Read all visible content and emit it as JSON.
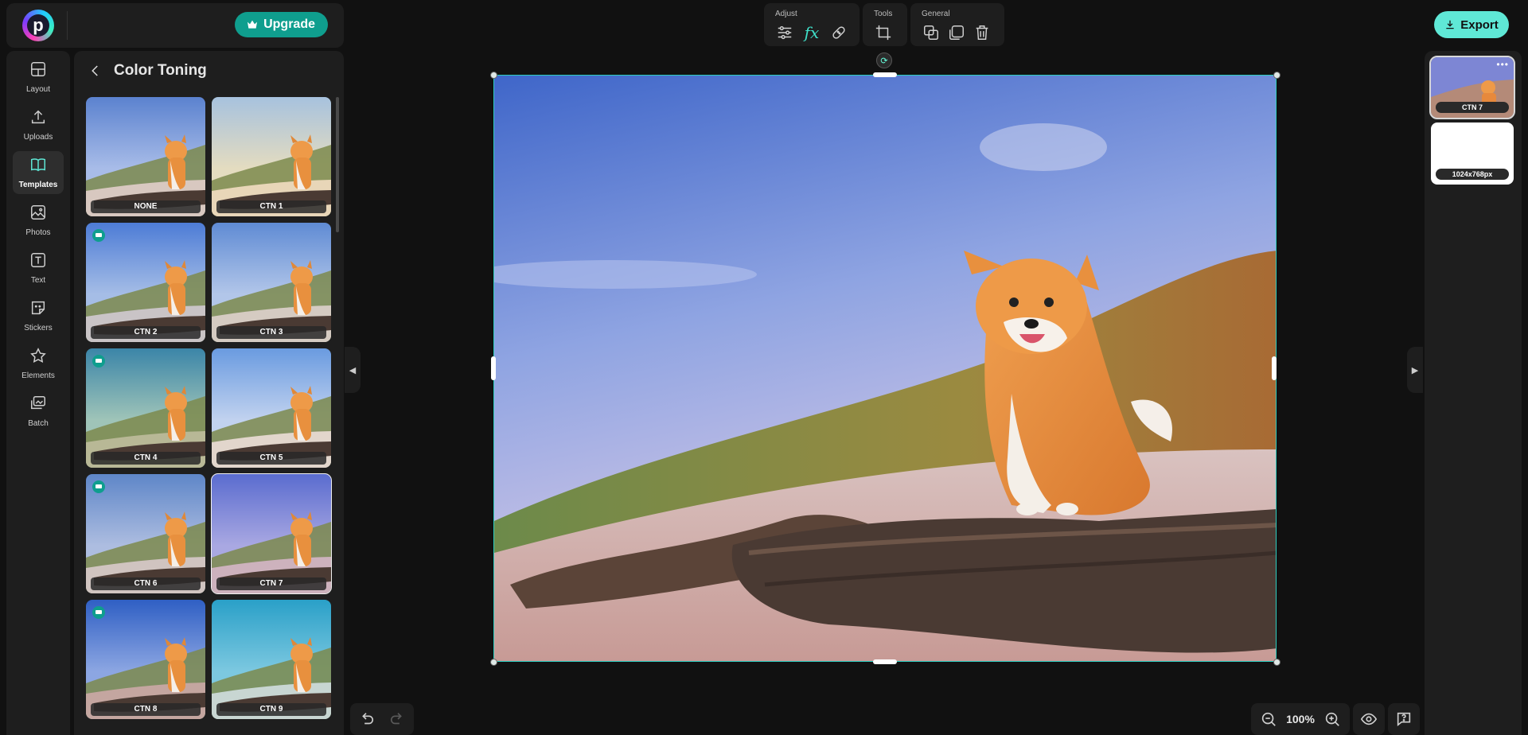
{
  "header": {
    "logo_letter": "p",
    "upgrade_label": "Upgrade",
    "export_label": "Export",
    "tool_groups": [
      {
        "label": "Adjust",
        "icons": [
          "sliders-icon",
          "fx-icon",
          "bandage-icon"
        ]
      },
      {
        "label": "Tools",
        "icons": [
          "crop-icon"
        ]
      },
      {
        "label": "General",
        "icons": [
          "duplicate-icon",
          "copy-icon",
          "trash-icon"
        ]
      }
    ],
    "fx_text": "fx"
  },
  "rail": {
    "items": [
      {
        "label": "Layout",
        "icon": "layout-icon"
      },
      {
        "label": "Uploads",
        "icon": "upload-icon"
      },
      {
        "label": "Templates",
        "icon": "book-icon",
        "active": true
      },
      {
        "label": "Photos",
        "icon": "image-icon"
      },
      {
        "label": "Text",
        "icon": "text-icon"
      },
      {
        "label": "Stickers",
        "icon": "sticker-icon"
      },
      {
        "label": "Elements",
        "icon": "star-icon"
      },
      {
        "label": "Batch",
        "icon": "batch-icon"
      }
    ]
  },
  "panel": {
    "title": "Color Toning",
    "filters": [
      {
        "label": "NONE",
        "premium": false,
        "selected": false,
        "tone": "none"
      },
      {
        "label": "CTN 1",
        "premium": false,
        "selected": false,
        "tone": "warm-haze"
      },
      {
        "label": "CTN 2",
        "premium": true,
        "selected": false,
        "tone": "cool"
      },
      {
        "label": "CTN 3",
        "premium": false,
        "selected": false,
        "tone": "natural"
      },
      {
        "label": "CTN 4",
        "premium": true,
        "selected": false,
        "tone": "green"
      },
      {
        "label": "CTN 5",
        "premium": false,
        "selected": false,
        "tone": "bright"
      },
      {
        "label": "CTN 6",
        "premium": true,
        "selected": false,
        "tone": "soft"
      },
      {
        "label": "CTN 7",
        "premium": false,
        "selected": true,
        "tone": "violet"
      },
      {
        "label": "CTN 8",
        "premium": true,
        "selected": false,
        "tone": "deep-blue"
      },
      {
        "label": "CTN 9",
        "premium": false,
        "selected": false,
        "tone": "teal"
      }
    ]
  },
  "layers": {
    "active_label": "CTN 7",
    "page_size_label": "1024x768px"
  },
  "footer": {
    "zoom": "100%"
  },
  "colors": {
    "accent": "#5fe8d6",
    "upgrade": "#0f9e8e",
    "selection": "#2ccdc0",
    "panel_bg": "#1e1e1e",
    "app_bg": "#111111"
  }
}
